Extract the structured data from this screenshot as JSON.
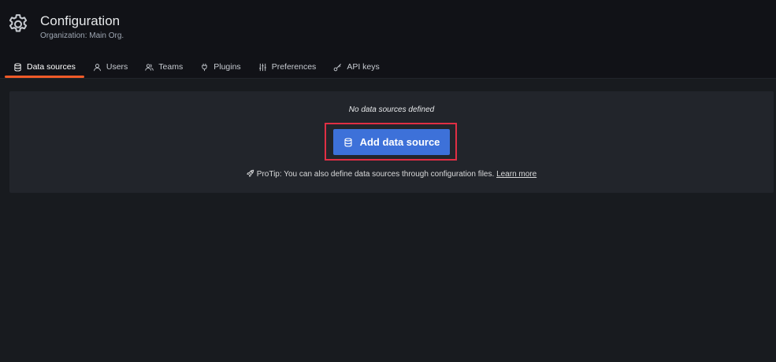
{
  "header": {
    "title": "Configuration",
    "subtitle": "Organization: Main Org.",
    "icon": "gear-icon"
  },
  "tabs": [
    {
      "label": "Data sources",
      "icon": "database-icon",
      "active": true
    },
    {
      "label": "Users",
      "icon": "user-icon",
      "active": false
    },
    {
      "label": "Teams",
      "icon": "users-icon",
      "active": false
    },
    {
      "label": "Plugins",
      "icon": "plug-icon",
      "active": false
    },
    {
      "label": "Preferences",
      "icon": "sliders-icon",
      "active": false
    },
    {
      "label": "API keys",
      "icon": "key-icon",
      "active": false
    }
  ],
  "empty_state": {
    "message": "No data sources defined",
    "button_label": "Add data source",
    "button_icon": "database-icon",
    "protip_text": "ProTip: You can also define data sources through configuration files.",
    "protip_link": "Learn more",
    "protip_icon": "rocket-icon"
  },
  "colors": {
    "background": "#181b1f",
    "header_background": "#111217",
    "panel_background": "#22252b",
    "primary_button": "#3d71d9",
    "active_tab_underline": "#f05a28",
    "highlight_border": "#e02f44"
  }
}
